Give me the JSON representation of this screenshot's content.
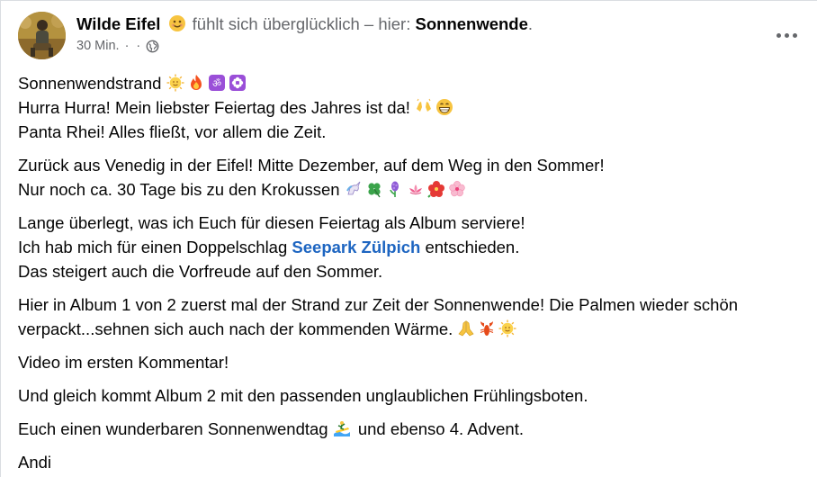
{
  "post": {
    "author": "Wilde Eifel",
    "status_text": "fühlt sich überglücklich – hier:",
    "place": "Sonnenwende",
    "period": ".",
    "time": "30 Min.",
    "dot": "·",
    "audience_icon": "globe-icon",
    "more_icon": "more-options-icon"
  },
  "content": {
    "p1": {
      "l1": "Sonnenwendstrand",
      "l2": "Hurra Hurra! Mein liebster Feiertag des Jahres ist da!",
      "l3": "Panta Rhei! Alles fließt, vor allem die Zeit."
    },
    "p2": {
      "l1": "Zurück aus Venedig in der Eifel! Mitte Dezember, auf dem Weg in den Sommer!",
      "l2": "Nur noch ca. 30 Tage bis zu den Krokussen"
    },
    "p3": {
      "l1": "Lange überlegt, was ich Euch für diesen Feiertag als Album serviere!",
      "l2a": "Ich hab mich für einen Doppelschlag",
      "l2link": "Seepark Zülpich",
      "l2b": "entschieden.",
      "l3": "Das steigert auch die Vorfreude auf den Sommer."
    },
    "p4": {
      "l1": "Hier in Album 1 von 2 zuerst mal der Strand zur Zeit der Sonnenwende! Die Palmen wieder schön",
      "l2": "verpackt...sehnen sich auch nach der kommenden Wärme."
    },
    "p5": "Video im ersten Kommentar!",
    "p6": "Und gleich kommt Album 2 mit den passenden unglaublichen Frühlingsboten.",
    "p7": {
      "a": "Euch einen wunderbaren Sonnenwendtag",
      "b": "und ebenso 4. Advent."
    },
    "p8": "Andi"
  },
  "colors": {
    "link": "#1d65c1",
    "muted": "#65676b",
    "text": "#050505"
  }
}
